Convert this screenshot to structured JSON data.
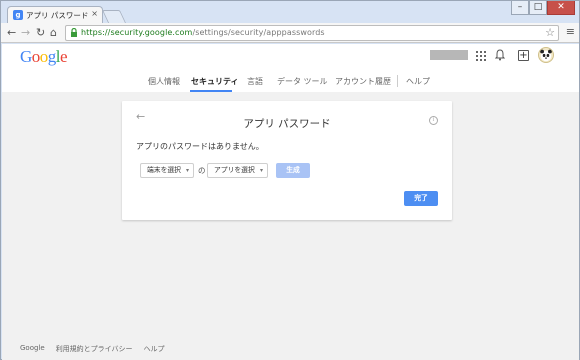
{
  "browser": {
    "tab_title": "アプリ パスワード - アカウント",
    "tab_close": "×",
    "url_domain": "https://security.google.com",
    "url_path": "/settings/security/apppasswords",
    "window_controls": {
      "minimize": "–",
      "maximize": "□",
      "close": "✕"
    }
  },
  "header": {
    "logo_letters": [
      "G",
      "o",
      "o",
      "g",
      "l",
      "e"
    ],
    "logo_colors": [
      "#4285f4",
      "#ea4335",
      "#fbbc05",
      "#4285f4",
      "#34a853",
      "#ea4335"
    ]
  },
  "nav": {
    "items": [
      {
        "label": "個人情報",
        "active": false
      },
      {
        "label": "セキュリティ",
        "active": true
      },
      {
        "label": "言語",
        "active": false
      },
      {
        "label": "データ ツール",
        "active": false
      },
      {
        "label": "アカウント履歴",
        "active": false
      },
      {
        "label": "ヘルプ",
        "active": false
      }
    ]
  },
  "card": {
    "back_icon": "←",
    "title": "アプリ パスワード",
    "info_icon": "i",
    "empty_message": "アプリのパスワードはありません。",
    "device_select": "端末を選択",
    "connector": "の",
    "app_select": "アプリを選択",
    "generate_label": "生成",
    "done_label": "完了"
  },
  "footer": {
    "links": [
      "Google",
      "利用規約とプライバシー",
      "ヘルプ"
    ]
  },
  "colors": {
    "accent_blue": "#4285f4",
    "primary_button": "#4d8ef2",
    "disabled_button": "#a9c3f5",
    "url_green": "#1a7a1a"
  }
}
